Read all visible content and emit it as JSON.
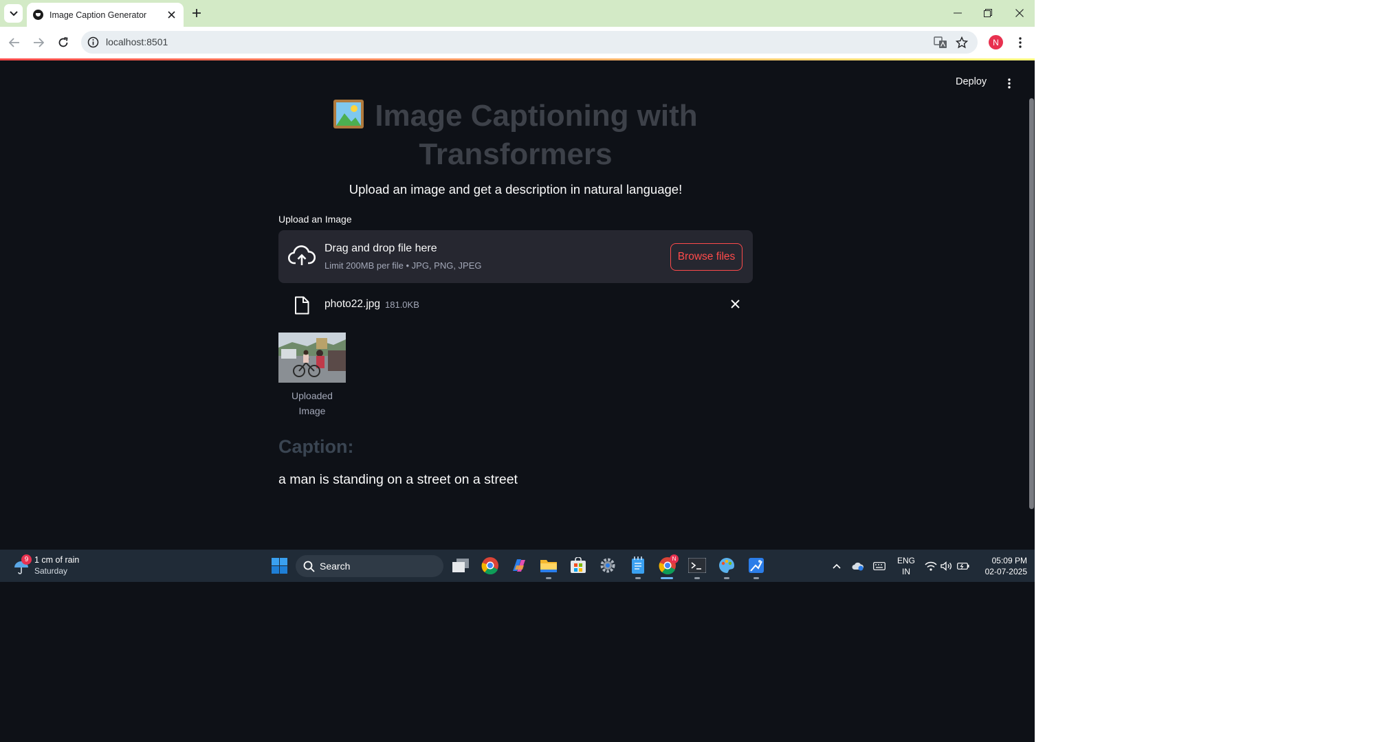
{
  "browser": {
    "tab_title": "Image Caption Generator",
    "url": "localhost:8501",
    "profile_initial": "N"
  },
  "app": {
    "deploy_label": "Deploy",
    "title_line1": "Image Captioning with",
    "title_line2": "Transformers",
    "subtitle": "Upload an image and get a description in natural language!",
    "uploader": {
      "label": "Upload an Image",
      "drag_text": "Drag and drop file here",
      "limit_text": "Limit 200MB per file • JPG, PNG, JPEG",
      "browse_label": "Browse files"
    },
    "uploaded_file": {
      "name": "photo22.jpg",
      "size": "181.0KB"
    },
    "image_caption_line1": "Uploaded",
    "image_caption_line2": "Image",
    "caption_heading": "Caption:",
    "caption_text": "a man is standing on a street on a street"
  },
  "taskbar": {
    "weather_badge": "9",
    "weather_main": "1 cm of rain",
    "weather_sub": "Saturday",
    "search_placeholder": "Search",
    "chrome_badge": "N",
    "lang_line1": "ENG",
    "lang_line2": "IN",
    "time": "05:09 PM",
    "date": "02-07-2025"
  },
  "colors": {
    "app_background": "#0e1117",
    "accent": "#ff4b4b",
    "titlebar": "#d3eac6",
    "taskbar": "#202b37"
  }
}
